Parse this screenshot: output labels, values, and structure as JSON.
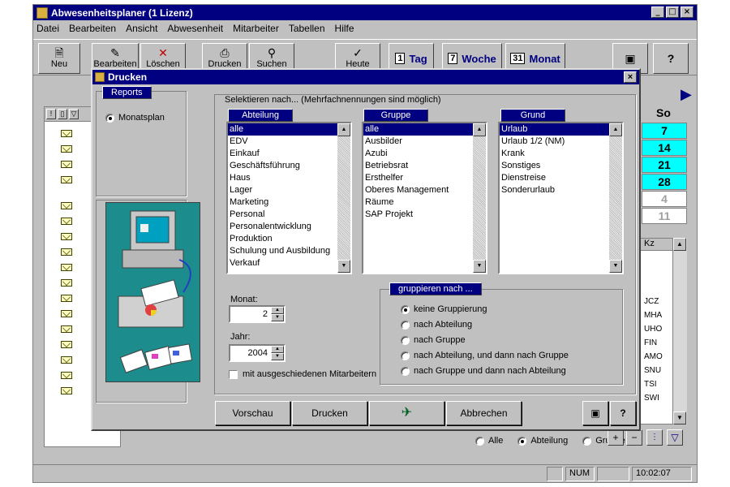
{
  "app": {
    "title": "Abwesenheitsplaner  (1 Lizenz)",
    "menu": [
      "Datei",
      "Bearbeiten",
      "Ansicht",
      "Abwesenheit",
      "Mitarbeiter",
      "Tabellen",
      "Hilfe"
    ],
    "toolbar": {
      "new": "Neu",
      "edit": "Bearbeiten",
      "delete": "Löschen",
      "print": "Drucken",
      "search": "Suchen",
      "today": "Heute",
      "day": "Tag",
      "day_num": "1",
      "week": "Woche",
      "week_num": "7",
      "month": "Monat",
      "month_num": "31"
    },
    "calendar": {
      "header": "So",
      "cells": [
        "7",
        "14",
        "21",
        "28",
        "4",
        "11"
      ]
    },
    "kz": {
      "header": "Kz",
      "codes": [
        "JCZ",
        "MHA",
        "UHO",
        "FIN",
        "AMO",
        "SNU",
        "TSI",
        "SWI"
      ]
    },
    "filter": {
      "all": "Alle",
      "department": "Abteilung",
      "group": "Gruppe"
    },
    "status": {
      "num": "NUM",
      "time": "10:02:07"
    }
  },
  "dialog": {
    "title": "Drucken",
    "close": "×",
    "reports_label": "Reports",
    "report_option": "Monatsplan",
    "select_hint": "Selektieren nach... (Mehrfachnennungen sind möglich)",
    "abteilung": {
      "label": "Abteilung",
      "items": [
        "alle",
        "EDV",
        "Einkauf",
        "Geschäftsführung",
        "Haus",
        "Lager",
        "Marketing",
        "Personal",
        "Personalentwicklung",
        "Produktion",
        "Schulung und Ausbildung",
        "Verkauf"
      ]
    },
    "gruppe": {
      "label": "Gruppe",
      "items": [
        "alle",
        "Ausbilder",
        "Azubi",
        "Betriebsrat",
        "Ersthelfer",
        "Oberes Management",
        "Räume",
        "SAP Projekt"
      ]
    },
    "grund": {
      "label": "Grund",
      "items": [
        "Urlaub",
        "Urlaub 1/2 (NM)",
        "Krank",
        "Sonstiges",
        "Dienstreise",
        "Sonderurlaub"
      ]
    },
    "month_label": "Monat:",
    "month_value": "2",
    "year_label": "Jahr:",
    "year_value": "2004",
    "include_former": "mit ausgeschiedenen Mitarbeitern",
    "grouping": {
      "label": "gruppieren nach ...",
      "options": [
        "keine Gruppierung",
        "nach Abteilung",
        "nach Gruppe",
        "nach Abteilung, und dann nach Gruppe",
        "nach Gruppe und dann nach Abteilung"
      ]
    },
    "buttons": {
      "preview": "Vorschau",
      "print": "Drucken",
      "cancel": "Abbrechen",
      "help": "?"
    }
  }
}
